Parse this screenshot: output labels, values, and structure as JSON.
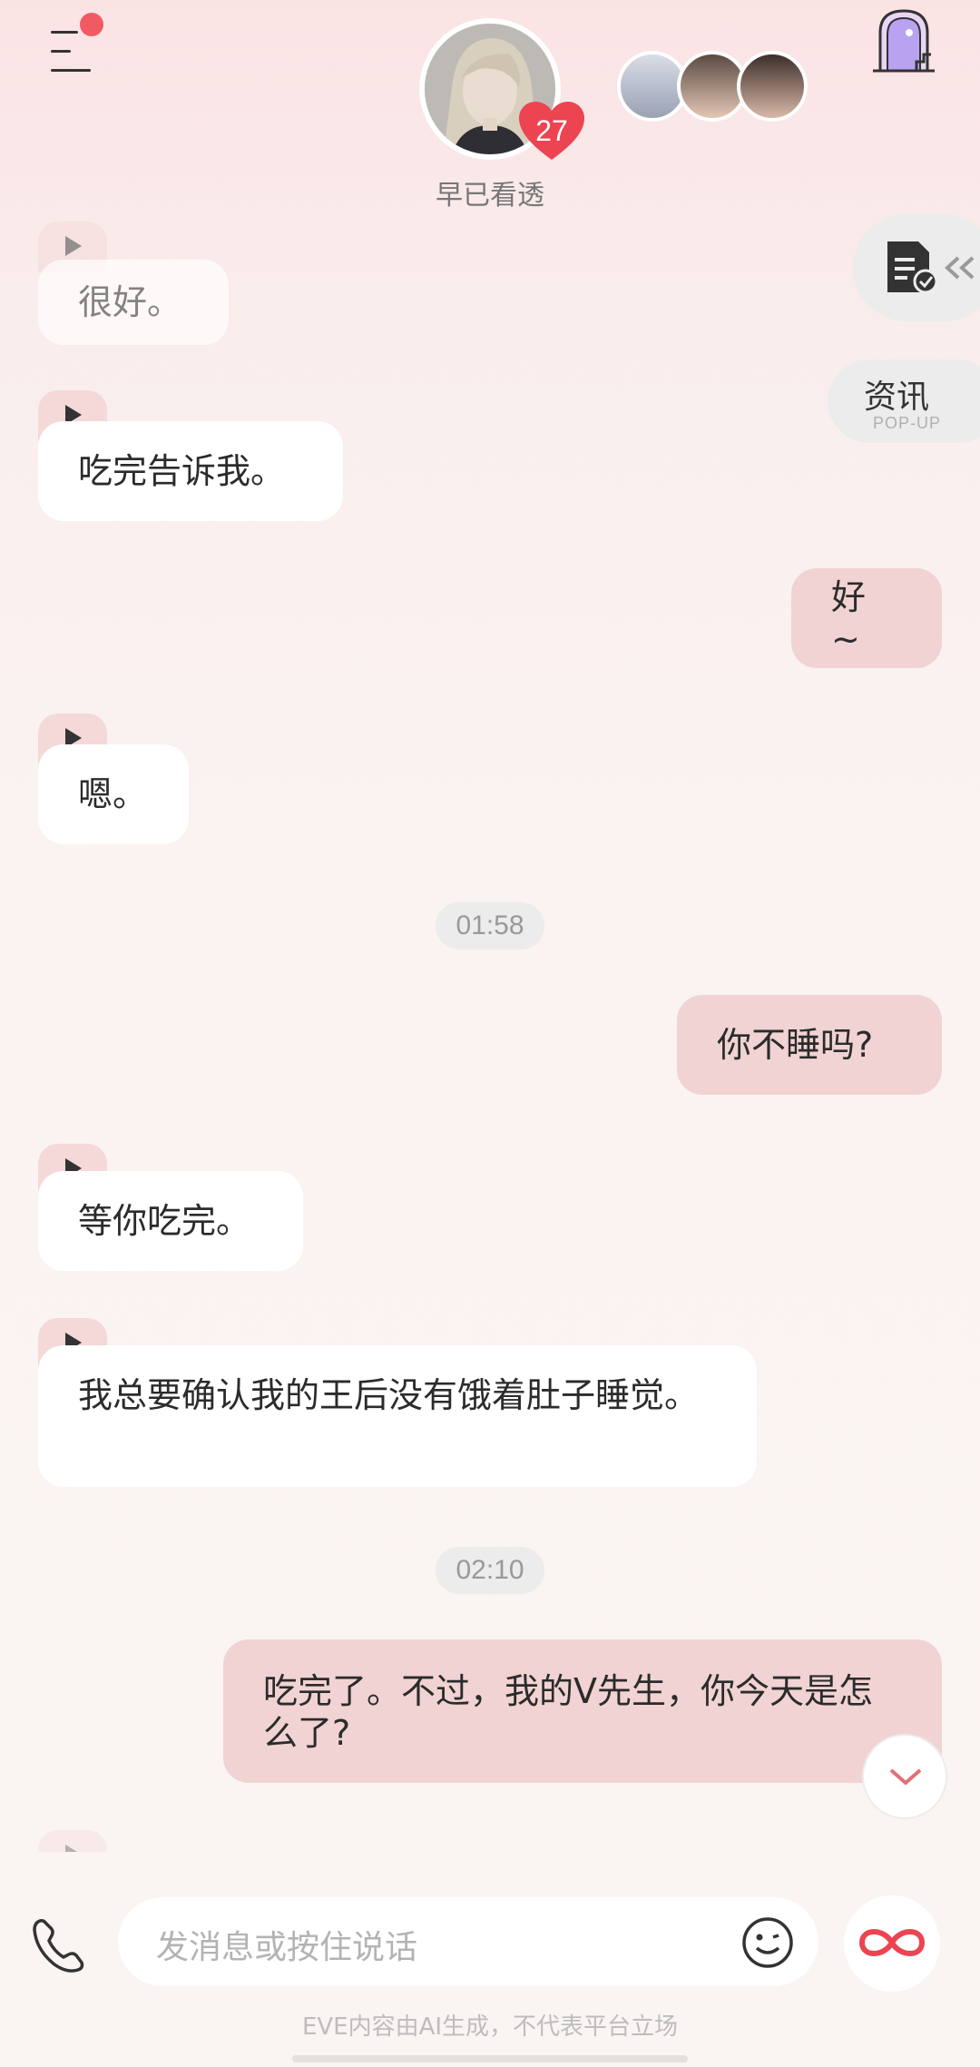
{
  "header": {
    "character_name": "早已看透",
    "affinity_level": "27"
  },
  "side": {
    "news_label": "资讯",
    "news_sublabel": "POP-UP"
  },
  "messages": [
    {
      "from": "character",
      "text": "很好。"
    },
    {
      "from": "character",
      "text": "吃完告诉我。"
    },
    {
      "from": "user",
      "text": "好 ~"
    },
    {
      "from": "character",
      "text": "嗯。"
    },
    {
      "from": "time",
      "text": "01:58"
    },
    {
      "from": "user",
      "text": "你不睡吗?"
    },
    {
      "from": "character",
      "text": "等你吃完。"
    },
    {
      "from": "character",
      "text": "我总要确认我的王后没有饿着肚子睡觉。"
    },
    {
      "from": "time",
      "text": "02:10"
    },
    {
      "from": "user",
      "text": "吃完了。不过，我的V先生，你今天是怎么了?"
    }
  ],
  "composer": {
    "placeholder": "发消息或按住说话"
  },
  "footer": {
    "disclaimer": "EVE内容由AI生成，不代表平台立场"
  },
  "colors": {
    "accent": "#f25a63",
    "user_bubble": "#f1d3d3",
    "character_bubble": "#ffffff"
  },
  "icons": [
    "menu-icon",
    "heart-badge-icon",
    "door-portal-icon",
    "task-document-icon",
    "chevron-double-left-icon",
    "play-icon",
    "chevron-down-icon",
    "phone-icon",
    "emoji-icon",
    "infinity-icon"
  ]
}
